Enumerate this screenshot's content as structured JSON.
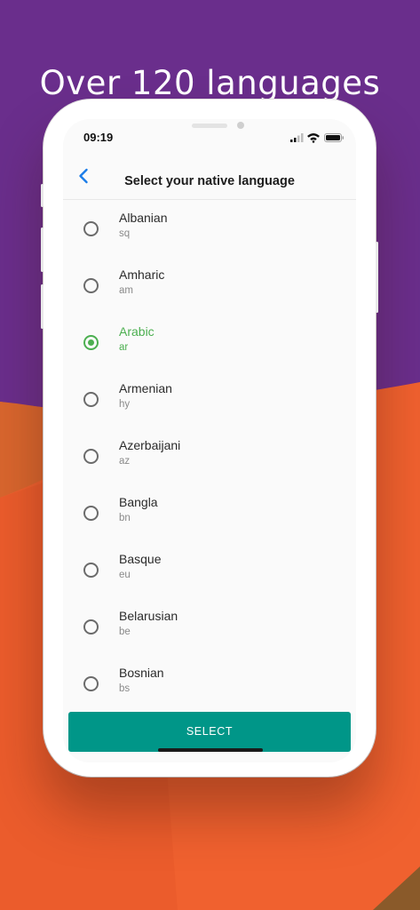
{
  "banner": {
    "headline": "Over 120 languages"
  },
  "colors": {
    "background_top": "#6a2e8c",
    "background_bottom": "#f0612f",
    "accent_selected": "#4caf50",
    "select_button": "#009688",
    "back_arrow": "#1a7ce8"
  },
  "status_bar": {
    "time": "09:19",
    "icons": [
      "cellular-signal-icon",
      "wifi-icon",
      "battery-icon"
    ]
  },
  "navbar": {
    "back_icon": "chevron-left-icon",
    "title": "Select your native language"
  },
  "languages": [
    {
      "name": "Albanian",
      "code": "sq",
      "selected": false
    },
    {
      "name": "Amharic",
      "code": "am",
      "selected": false
    },
    {
      "name": "Arabic",
      "code": "ar",
      "selected": true
    },
    {
      "name": "Armenian",
      "code": "hy",
      "selected": false
    },
    {
      "name": "Azerbaijani",
      "code": "az",
      "selected": false
    },
    {
      "name": "Bangla",
      "code": "bn",
      "selected": false
    },
    {
      "name": "Basque",
      "code": "eu",
      "selected": false
    },
    {
      "name": "Belarusian",
      "code": "be",
      "selected": false
    },
    {
      "name": "Bosnian",
      "code": "bs",
      "selected": false
    }
  ],
  "footer": {
    "select_label": "SELECT"
  }
}
